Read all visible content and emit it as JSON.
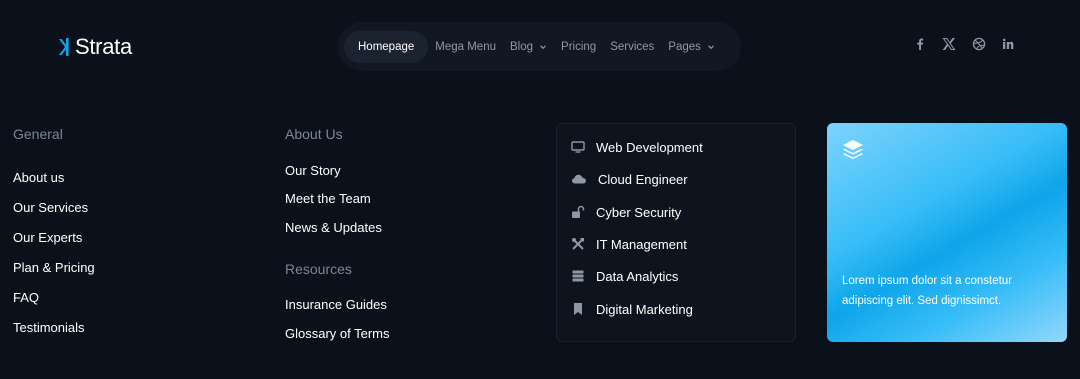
{
  "brand": {
    "name": "Strata",
    "accent": "#0ea5e9"
  },
  "nav": {
    "items": [
      {
        "label": "Homepage"
      },
      {
        "label": "Mega Menu"
      },
      {
        "label": "Blog"
      },
      {
        "label": "Pricing"
      },
      {
        "label": "Services"
      },
      {
        "label": "Pages"
      }
    ]
  },
  "social": [
    "facebook-icon",
    "x-icon",
    "dribbble-icon",
    "linkedin-icon"
  ],
  "general": {
    "title": "General",
    "links": [
      "About us",
      "Our Services",
      "Our Experts",
      "Plan & Pricing",
      "FAQ",
      "Testimonials"
    ]
  },
  "about": {
    "title": "About Us",
    "links": [
      "Our Story",
      "Meet the Team",
      "News & Updates"
    ]
  },
  "resources": {
    "title": "Resources",
    "links": [
      "Insurance Guides",
      "Glossary of Terms"
    ]
  },
  "mega": {
    "items": [
      {
        "label": "Web Development",
        "icon": "monitor-icon"
      },
      {
        "label": "Cloud Engineer",
        "icon": "cloud-icon"
      },
      {
        "label": "Cyber Security",
        "icon": "lock-open-icon"
      },
      {
        "label": "IT Management",
        "icon": "tools-icon"
      },
      {
        "label": "Data Analytics",
        "icon": "server-icon"
      },
      {
        "label": "Digital Marketing",
        "icon": "bookmark-icon"
      }
    ]
  },
  "promo": {
    "text": "Lorem ipsum dolor sit a constetur adipiscing elit. Sed dignissimct.",
    "icon": "layers-icon"
  }
}
